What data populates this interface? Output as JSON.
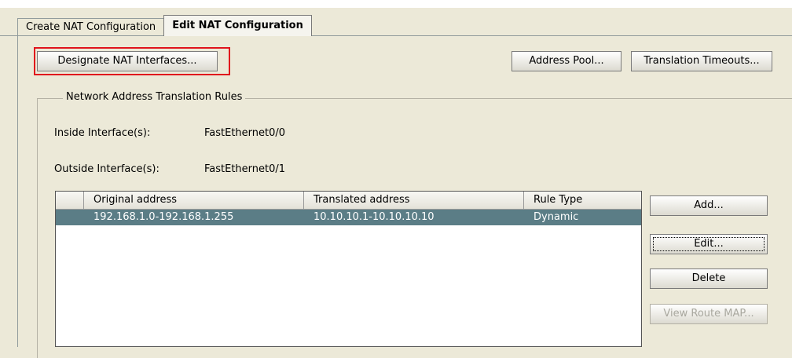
{
  "tabs": [
    {
      "label": "Create NAT Configuration",
      "active": false
    },
    {
      "label": "Edit NAT Configuration",
      "active": true
    }
  ],
  "toolbar": {
    "designate_label": "Designate NAT Interfaces...",
    "address_pool_label": "Address Pool...",
    "translation_timeouts_label": "Translation Timeouts..."
  },
  "rules_group": {
    "title": "Network Address Translation Rules",
    "inside_label": "Inside Interface(s):",
    "inside_value": "FastEthernet0/0",
    "outside_label": "Outside Interface(s):",
    "outside_value": "FastEthernet0/1"
  },
  "table": {
    "columns": [
      "",
      "Original address",
      "Translated address",
      "Rule Type"
    ],
    "rows": [
      {
        "marker": "",
        "original": "192.168.1.0-192.168.1.255",
        "translated": "10.10.10.1-10.10.10.10",
        "type": "Dynamic",
        "selected": true
      }
    ]
  },
  "actions": {
    "add": "Add...",
    "edit": "Edit...",
    "delete": "Delete",
    "view_route_map": "View Route MAP..."
  },
  "colors": {
    "highlight": "#e0141c",
    "selected_row": "#5b7d86"
  }
}
